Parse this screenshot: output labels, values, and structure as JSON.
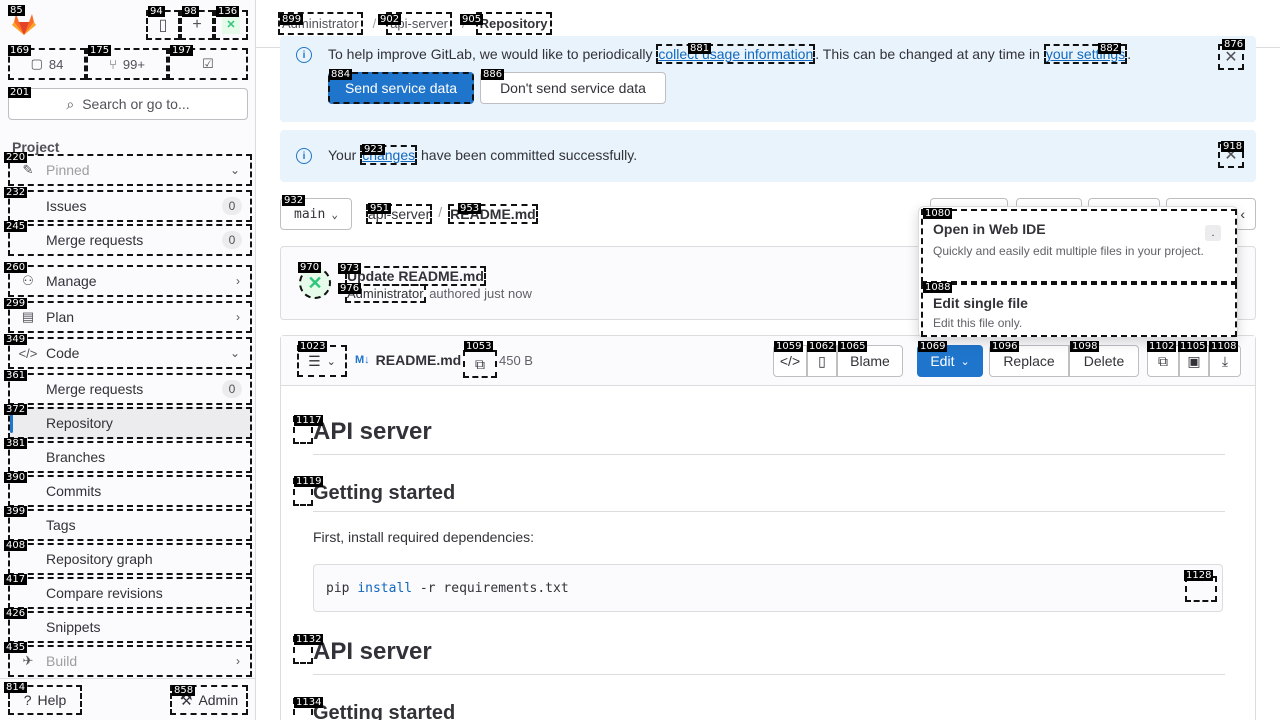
{
  "sidebar": {
    "counters": [
      {
        "icon": "issues-icon",
        "value": "84"
      },
      {
        "icon": "merge-request-icon",
        "value": "99+"
      },
      {
        "icon": "todo-icon",
        "value": ""
      }
    ],
    "search_label": "Search or go to...",
    "section_title": "Project",
    "items": {
      "pinned": "Pinned",
      "issues": "Issues",
      "issues_count": "0",
      "merge_requests": "Merge requests",
      "merge_requests_count": "0",
      "manage": "Manage",
      "plan": "Plan",
      "code": "Code",
      "code_merge_requests": "Merge requests",
      "code_merge_requests_count": "0",
      "repository": "Repository",
      "branches": "Branches",
      "commits": "Commits",
      "tags": "Tags",
      "repository_graph": "Repository graph",
      "compare_revisions": "Compare revisions",
      "snippets": "Snippets",
      "build": "Build"
    },
    "help_label": "Help",
    "admin_label": "Admin"
  },
  "breadcrumb": {
    "items": [
      "Administrator",
      "api-server",
      "Repository"
    ]
  },
  "alerts": {
    "usage_text_1": "To help improve GitLab, we would like to periodically ",
    "usage_link": "collect usage information",
    "usage_text_2": ". This can be changed at any time in ",
    "usage_settings_link": "your settings",
    "usage_text_3": ".",
    "send_button": "Send service data",
    "dont_send_button": "Don't send service data",
    "success_text_1": "Your ",
    "success_link": "changes",
    "success_text_2": " have been committed successfully."
  },
  "ref": {
    "branch": "main",
    "project": "api-server",
    "file": "README.md"
  },
  "commit": {
    "title": "Update README.md",
    "author": "Administrator",
    "meta": "authored just now"
  },
  "file": {
    "name": "README.md",
    "size": "450 B",
    "blame_label": "Blame",
    "edit_label": "Edit",
    "replace_label": "Replace",
    "delete_label": "Delete"
  },
  "edit_menu": {
    "web_ide_title": "Open in Web IDE",
    "web_ide_desc": "Quickly and easily edit multiple files in your project.",
    "web_ide_shortcut": ".",
    "single_title": "Edit single file",
    "single_desc": "Edit this file only."
  },
  "readme": {
    "h1_a": "API server",
    "h2_a": "Getting started",
    "p_a": "First, install required dependencies:",
    "code_cmd": "pip",
    "code_kw": "install",
    "code_rest": " -r requirements.txt",
    "h1_b": "API server",
    "h2_b": "Getting started"
  },
  "colors": {
    "accent": "#1f75cb",
    "alert_bg": "#e9f3fc",
    "logo": "#fc6d26"
  }
}
